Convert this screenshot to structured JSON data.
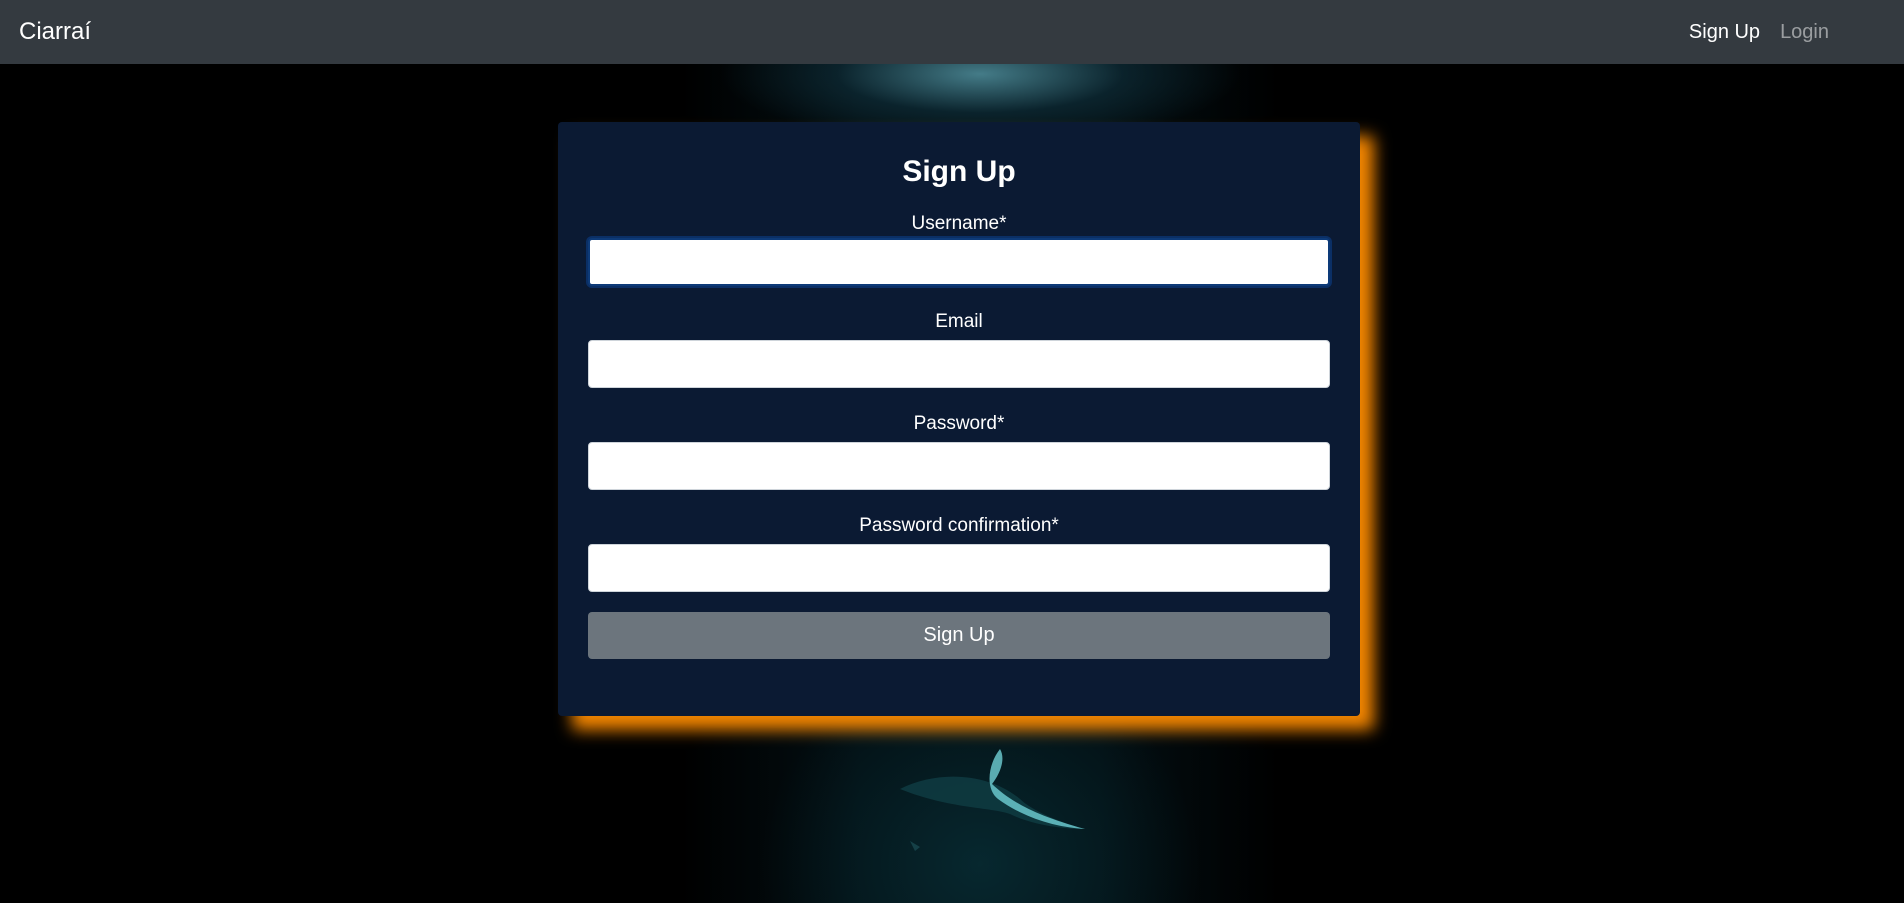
{
  "navbar": {
    "brand": "Ciarraí",
    "links": [
      {
        "label": "Sign Up",
        "state": "active"
      },
      {
        "label": "Login",
        "state": "muted"
      }
    ]
  },
  "form": {
    "title": "Sign Up",
    "fields": [
      {
        "label": "Username*",
        "value": "",
        "focused": true
      },
      {
        "label": "Email",
        "value": ""
      },
      {
        "label": "Password*",
        "value": ""
      },
      {
        "label": "Password confirmation*",
        "value": ""
      }
    ],
    "submit_label": "Sign Up"
  },
  "colors": {
    "navbar_bg": "#343a40",
    "card_bg": "#0b1a33",
    "card_glow": "#ff8c00",
    "button_bg": "#6c757d",
    "input_focus_border": "#0d3a78"
  }
}
